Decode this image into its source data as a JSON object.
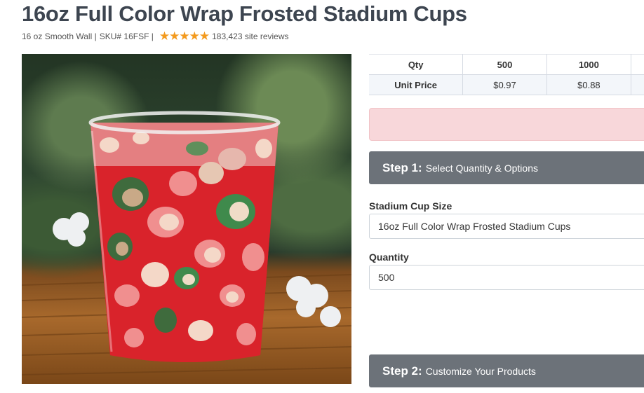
{
  "product": {
    "title": "16oz Full Color Wrap Frosted Stadium Cups",
    "wall": "16 oz Smooth Wall |",
    "sku": "SKU# 16FSF |",
    "rating_stars": 5,
    "reviews": "183,423 site reviews",
    "image_alt": "Red leopard print frosted stadium cup on bamboo mat"
  },
  "pricing": {
    "qty_label": "Qty",
    "unit_price_label": "Unit Price",
    "tiers": [
      {
        "qty": "500",
        "price": "$0.97"
      },
      {
        "qty": "1000",
        "price": "$0.88"
      }
    ]
  },
  "steps": {
    "step1_num": "Step 1:",
    "step1_text": "Select Quantity & Options",
    "step2_num": "Step 2:",
    "step2_text": "Customize Your Products"
  },
  "form": {
    "size_label": "Stadium Cup Size",
    "size_value": "16oz Full Color Wrap Frosted Stadium Cups",
    "quantity_label": "Quantity",
    "quantity_value": "500"
  },
  "colors": {
    "star": "#f39a1e",
    "step_bg": "#6c7279",
    "alert_bg": "#f8d7da",
    "title": "#3d4550"
  }
}
